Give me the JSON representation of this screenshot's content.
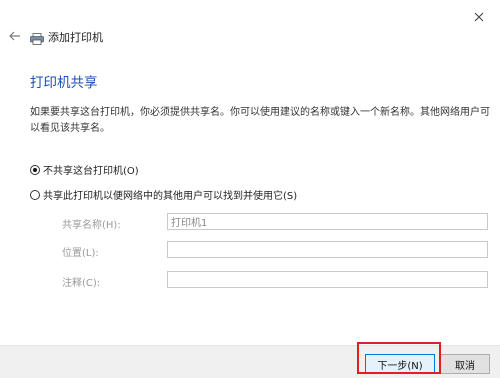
{
  "header": {
    "title": "添加打印机",
    "back_icon": "back-arrow-icon",
    "close_icon": "close-icon"
  },
  "section": {
    "title": "打印机共享",
    "description": "如果要共享这台打印机，你必须提供共享名。你可以使用建议的名称或键入一个新名称。其他网络用户可以看见该共享名。"
  },
  "options": {
    "no_share_label": "不共享这台打印机(O)",
    "share_label": "共享此打印机以便网络中的其他用户可以找到并使用它(S)",
    "selected": "no_share"
  },
  "fields": {
    "share_name": {
      "label": "共享名称(H):",
      "value": "打印机1"
    },
    "location": {
      "label": "位置(L):",
      "value": ""
    },
    "comment": {
      "label": "注释(C):",
      "value": ""
    }
  },
  "footer": {
    "next_label": "下一步(N)",
    "cancel_label": "取消"
  },
  "colors": {
    "accent": "#1a4fb5",
    "highlight": "#e02020"
  }
}
